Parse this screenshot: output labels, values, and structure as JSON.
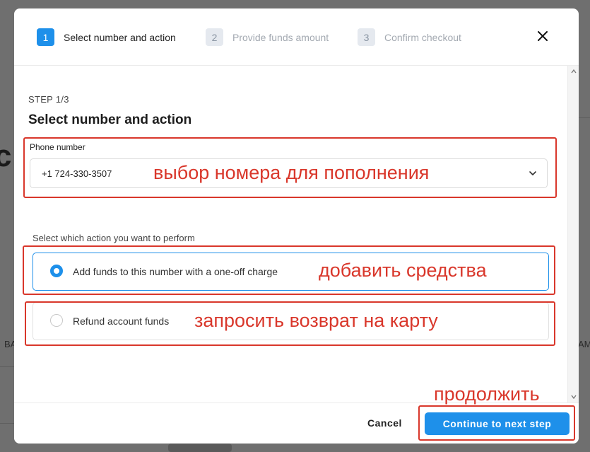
{
  "background": {
    "partial_texts": [
      "c",
      "BA",
      "AM"
    ]
  },
  "stepper": {
    "steps": [
      {
        "number": "1",
        "label": "Select number and action",
        "state": "active"
      },
      {
        "number": "2",
        "label": "Provide funds amount",
        "state": "inactive"
      },
      {
        "number": "3",
        "label": "Confirm checkout",
        "state": "inactive"
      }
    ],
    "close_icon": "close-icon"
  },
  "form": {
    "step_kicker": "STEP 1/3",
    "title": "Select number and action",
    "phone_label": "Phone number",
    "phone_value": "+1 724-330-3507",
    "action_prompt": "Select which action you want to perform",
    "options": [
      {
        "label": "Add funds to this number with a one-off charge",
        "selected": true
      },
      {
        "label": "Refund account funds",
        "selected": false
      }
    ]
  },
  "footer": {
    "cancel_label": "Cancel",
    "continue_label": "Continue to next step"
  },
  "annotations": {
    "phone": "выбор номера для пополнения",
    "add_funds": "добавить средства",
    "refund": "запросить возврат на карту",
    "continue": "продолжить"
  },
  "colors": {
    "accent": "#1e90ea",
    "annotation": "#d9372b",
    "overlay": "#6f6f6f"
  }
}
